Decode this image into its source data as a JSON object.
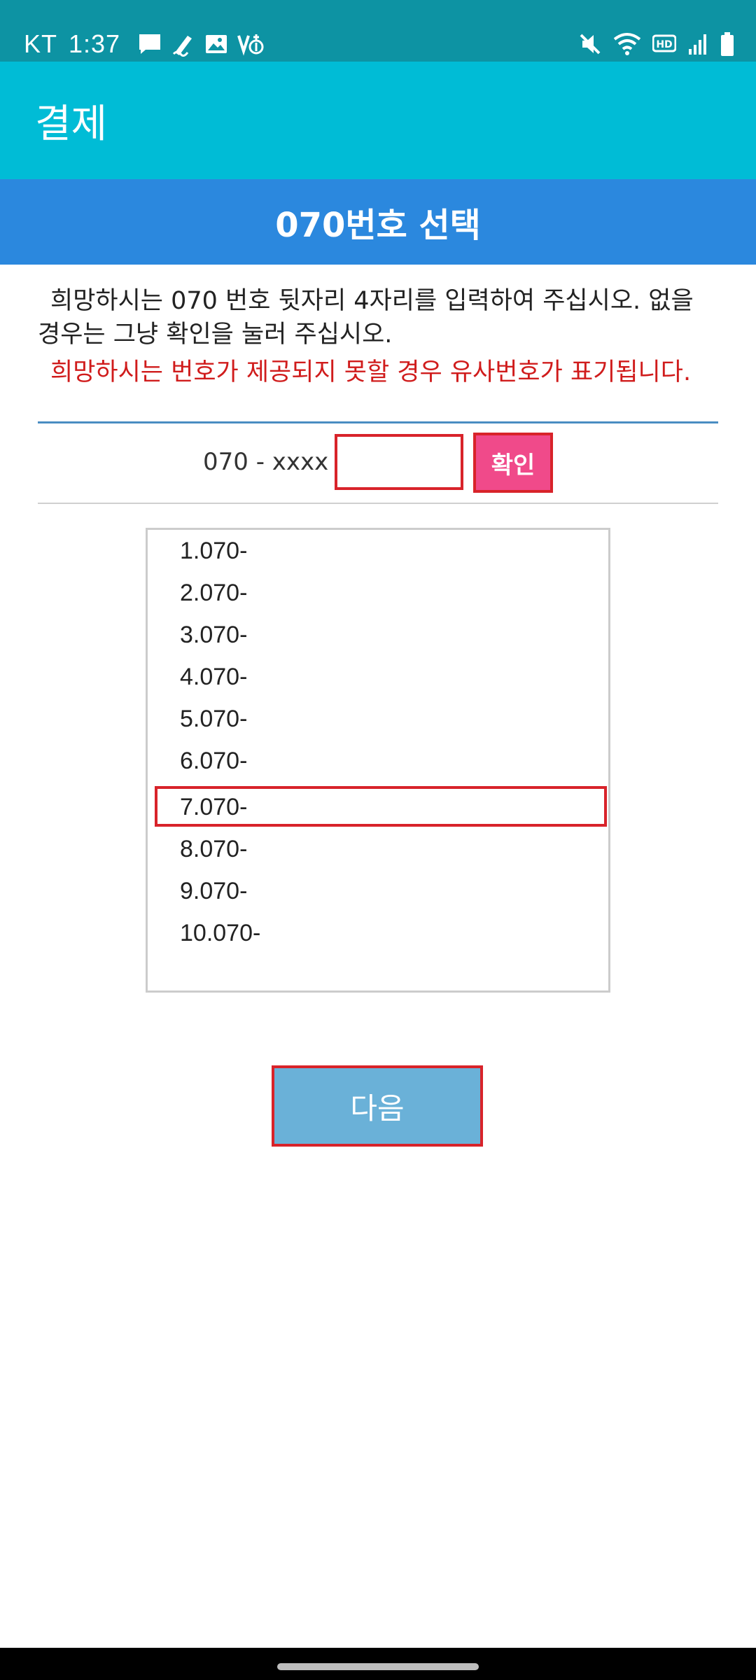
{
  "status_bar": {
    "carrier": "KT",
    "time": "1:37",
    "left_icons": [
      "message-icon",
      "signature-icon",
      "image-icon",
      "volte-icon"
    ],
    "right_icons": [
      "mute-icon",
      "wifi-icon",
      "hd-icon",
      "signal-icon",
      "battery-icon"
    ],
    "hd_label": "HD"
  },
  "app_bar": {
    "title": "결제"
  },
  "section": {
    "title": "070번호 선택"
  },
  "instructions": {
    "line1": "희망하시는 070 번호 뒷자리 4자리를 입력하여 주십시오. 없을",
    "line2": "경우는 그냥 확인을 눌러 주십시오.",
    "warning": "희망하시는 번호가 제공되지 못할 경우 유사번호가 표기됩니다."
  },
  "number_input": {
    "prefix": "070 - xxxx -",
    "value": "",
    "placeholder": "",
    "confirm_label": "확인"
  },
  "number_list": {
    "items": [
      "1.070-",
      "2.070-",
      "3.070-",
      "4.070-",
      "5.070-",
      "6.070-",
      "7.070-",
      "8.070-",
      "9.070-",
      "10.070-"
    ],
    "highlighted_index": 6
  },
  "next_button": {
    "label": "다음"
  },
  "colors": {
    "status_bar": "#0d93a3",
    "app_bar": "#00bcd6",
    "section_header": "#2b88de",
    "warning_text": "#d01c1c",
    "confirm_button": "#f04a8a",
    "next_button": "#6ab1d8",
    "highlight_border": "#d8232a"
  }
}
